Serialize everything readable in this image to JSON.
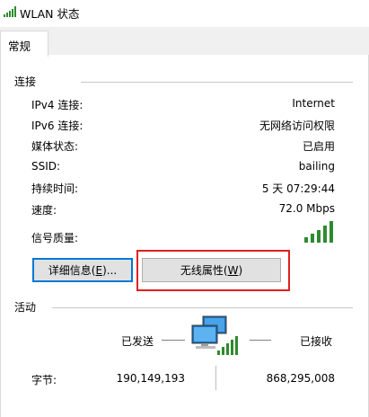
{
  "window": {
    "title": "WLAN 状态",
    "icon": "wifi-signal-icon"
  },
  "tabs": [
    {
      "label": "常规",
      "selected": true
    }
  ],
  "connection": {
    "section_title": "连接",
    "rows": [
      {
        "label": "IPv4 连接:",
        "value": "Internet"
      },
      {
        "label": "IPv6 连接:",
        "value": "无网络访问权限"
      },
      {
        "label": "媒体状态:",
        "value": "已启用"
      },
      {
        "label": "SSID:",
        "value": "bailing"
      },
      {
        "label": "持续时间:",
        "value": "5 天 07:29:44"
      },
      {
        "label": "速度:",
        "value": "72.0 Mbps"
      }
    ],
    "signal_label": "信号质量:",
    "signal_bars_active": 5,
    "signal_bars_total": 5,
    "signal_color": "#2e8b2e"
  },
  "buttons": {
    "details_prefix": "详细信息(",
    "details_mnemonic": "E",
    "details_suffix": ")...",
    "wireless_prefix": "无线属性(",
    "wireless_mnemonic": "W",
    "wireless_suffix": ")"
  },
  "activity": {
    "section_title": "活动",
    "sent_label": "已发送",
    "received_label": "已接收",
    "bytes_label": "字节:",
    "bytes_sent": "190,149,193",
    "bytes_received": "868,295,008",
    "icon": "network-computers-icon"
  },
  "colors": {
    "highlight_border": "#e02020",
    "focus_border": "#0078d7"
  }
}
